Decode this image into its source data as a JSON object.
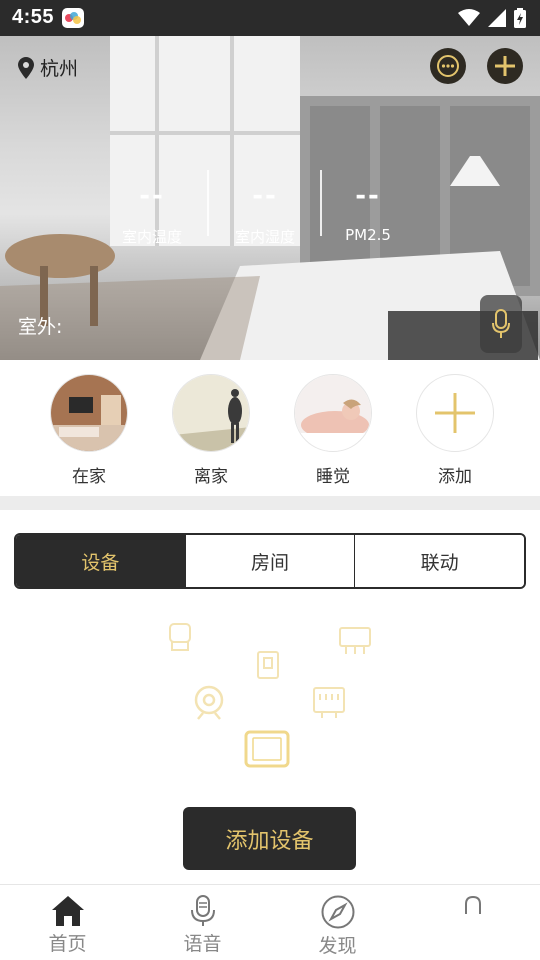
{
  "status": {
    "time": "4:55"
  },
  "header": {
    "city": "杭州"
  },
  "hero": {
    "metrics": [
      {
        "value": "--",
        "label": "室内温度"
      },
      {
        "value": "--",
        "label": "室内湿度"
      },
      {
        "value": "--",
        "label": "PM2.5"
      }
    ],
    "outdoor_label": "室外:"
  },
  "scenes": [
    {
      "label": "在家"
    },
    {
      "label": "离家"
    },
    {
      "label": "睡觉"
    },
    {
      "label": "添加"
    }
  ],
  "tabs": [
    {
      "label": "设备",
      "active": true
    },
    {
      "label": "房间",
      "active": false
    },
    {
      "label": "联动",
      "active": false
    }
  ],
  "add_device_label": "添加设备",
  "nav": [
    {
      "label": "首页",
      "icon": "home-icon"
    },
    {
      "label": "语音",
      "icon": "microphone-icon"
    },
    {
      "label": "发现",
      "icon": "compass-icon"
    },
    {
      "label": "",
      "icon": "profile-icon"
    }
  ],
  "colors": {
    "accent": "#e3c46c",
    "dark": "#2b2b2b",
    "page_bg": "#ffffff",
    "divider": "#ececec"
  }
}
